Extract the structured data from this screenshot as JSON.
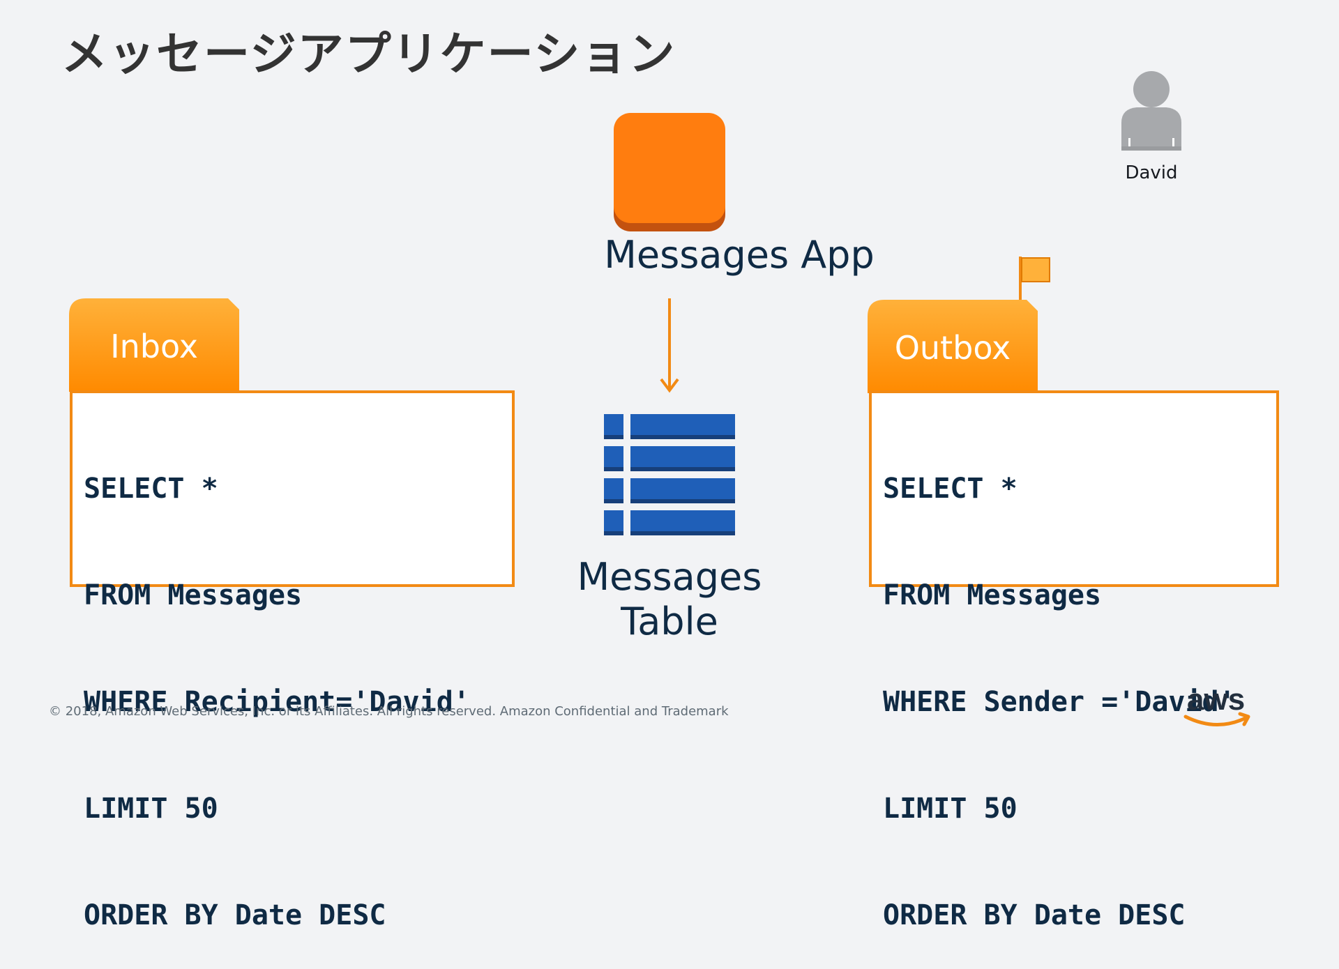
{
  "title": "メッセージアプリケーション",
  "user": {
    "name": "David",
    "icon": "user-icon"
  },
  "app": {
    "label": "Messages App",
    "color": "#ff7d0f",
    "icon": "application-icon"
  },
  "table": {
    "label_lines": [
      "Messages",
      "Table"
    ],
    "color": "#1f5fb8",
    "icon": "table-icon"
  },
  "inbox": {
    "label": "Inbox",
    "query_lines": [
      "SELECT *",
      "FROM Messages",
      "WHERE Recipient='David'",
      "LIMIT 50",
      "ORDER BY Date DESC"
    ]
  },
  "outbox": {
    "label": "Outbox",
    "query_lines": [
      "SELECT *",
      "FROM Messages",
      "WHERE Sender ='David'",
      "LIMIT 50",
      "ORDER BY Date DESC"
    ]
  },
  "footer": {
    "copyright": "© 2018, Amazon Web Services, Inc. or its Affiliates. All rights reserved. Amazon Confidential and Trademark"
  },
  "brand": {
    "logo_text": "aws",
    "accent": "#f28a14",
    "logo_color": "#232f3e"
  }
}
